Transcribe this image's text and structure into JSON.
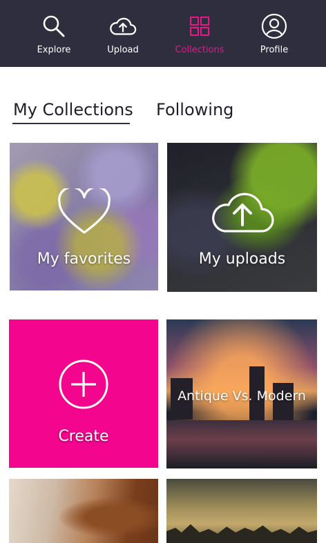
{
  "nav": {
    "items": [
      {
        "label": "Explore",
        "icon": "search-icon"
      },
      {
        "label": "Upload",
        "icon": "cloud-upload-icon"
      },
      {
        "label": "Collections",
        "icon": "grid-icon",
        "active": true
      },
      {
        "label": "Profile",
        "icon": "user-icon"
      }
    ],
    "background": "#2f2e3f",
    "active_color": "#e8178a"
  },
  "tabs": {
    "items": [
      {
        "label": "My Collections",
        "selected": true
      },
      {
        "label": "Following",
        "selected": false
      }
    ]
  },
  "tiles": [
    {
      "label": "My favorites",
      "icon": "heart-icon"
    },
    {
      "label": "My uploads",
      "icon": "cloud-upload-icon"
    },
    {
      "label": "Create",
      "icon": "plus-circle-icon",
      "color": "#f3058d"
    },
    {
      "label": "Antique Vs. Modern"
    },
    {
      "label": ""
    },
    {
      "label": ""
    }
  ]
}
